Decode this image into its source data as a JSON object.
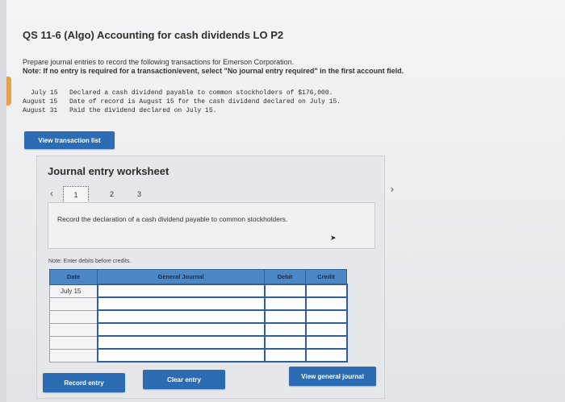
{
  "header": {
    "title": "QS 11-6 (Algo) Accounting for cash dividends LO P2",
    "instruction": "Prepare journal entries to record the following transactions for Emerson Corporation.",
    "note": "Note: If no entry is required for a transaction/event, select \"No journal entry required\" in the first account field."
  },
  "transactions": [
    {
      "date": "July 15",
      "text": "Declared a cash dividend payable to common stockholders of $176,000."
    },
    {
      "date": "August 15",
      "text": "Date of record is August 15 for the cash dividend declared on July 15."
    },
    {
      "date": "August 31",
      "text": "Paid the dividend declared on July 15."
    }
  ],
  "buttons": {
    "view_transaction_list": "View transaction list",
    "record_entry": "Record entry",
    "clear_entry": "Clear entry",
    "view_general_journal": "View general journal"
  },
  "worksheet": {
    "title": "Journal entry worksheet",
    "pages": [
      "1",
      "2",
      "3"
    ],
    "active_page": "1",
    "description": "Record the declaration of a cash dividend payable to common stockholders.",
    "entry_note": "Note: Enter debits before credits.",
    "columns": {
      "date": "Date",
      "account": "General Journal",
      "debit": "Debit",
      "credit": "Credit"
    },
    "rows": [
      {
        "date": "July 15",
        "account": "",
        "debit": "",
        "credit": ""
      },
      {
        "date": "",
        "account": "",
        "debit": "",
        "credit": ""
      },
      {
        "date": "",
        "account": "",
        "debit": "",
        "credit": ""
      },
      {
        "date": "",
        "account": "",
        "debit": "",
        "credit": ""
      },
      {
        "date": "",
        "account": "",
        "debit": "",
        "credit": ""
      },
      {
        "date": "",
        "account": "",
        "debit": "",
        "credit": ""
      }
    ]
  },
  "icons": {
    "prev": "chevron-left-icon",
    "next": "chevron-right-icon",
    "cursor": "mouse-cursor-icon"
  },
  "colors": {
    "primary_button": "#2b6cb3",
    "table_header": "#4b86c5",
    "accent_tab": "#e7a04a"
  }
}
